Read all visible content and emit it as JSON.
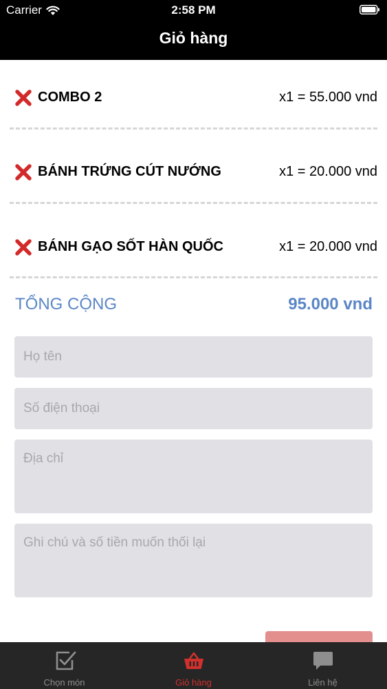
{
  "status_bar": {
    "carrier": "Carrier",
    "time": "2:58 PM"
  },
  "nav": {
    "title": "Giỏ hàng"
  },
  "cart": {
    "items": [
      {
        "name": "COMBO 2",
        "price": "x1 = 55.000 vnd"
      },
      {
        "name": " BÁNH TRỨNG CÚT NƯỚNG",
        "price": "x1 = 20.000 vnd"
      },
      {
        "name": "BÁNH GẠO SỐT HÀN QUỐC",
        "price": "x1 = 20.000 vnd"
      }
    ],
    "remove_icon": "red-x-icon",
    "total_label": "TỔNG CỘNG",
    "total_value": "95.000 vnd"
  },
  "form": {
    "name_placeholder": "Họ tên",
    "phone_placeholder": "Số điện thoại",
    "address_placeholder": "Địa chỉ",
    "note_placeholder": "Ghi chú và số tiền muốn thối lại"
  },
  "tabs": [
    {
      "label": "Chọn món",
      "icon": "checkbox-icon",
      "active": false
    },
    {
      "label": "Giỏ hàng",
      "icon": "basket-icon",
      "active": true
    },
    {
      "label": "Liên hệ",
      "icon": "chat-bubble-icon",
      "active": false
    }
  ],
  "colors": {
    "header_bg": "#000000",
    "accent_blue": "#5b86c6",
    "remove_red": "#d22a2a",
    "tab_active": "#d0312d",
    "tab_inactive": "#8e8e8e",
    "field_bg": "#e1e0e4",
    "submit_bg": "#e28f8e",
    "tab_bar_bg": "#262626"
  }
}
